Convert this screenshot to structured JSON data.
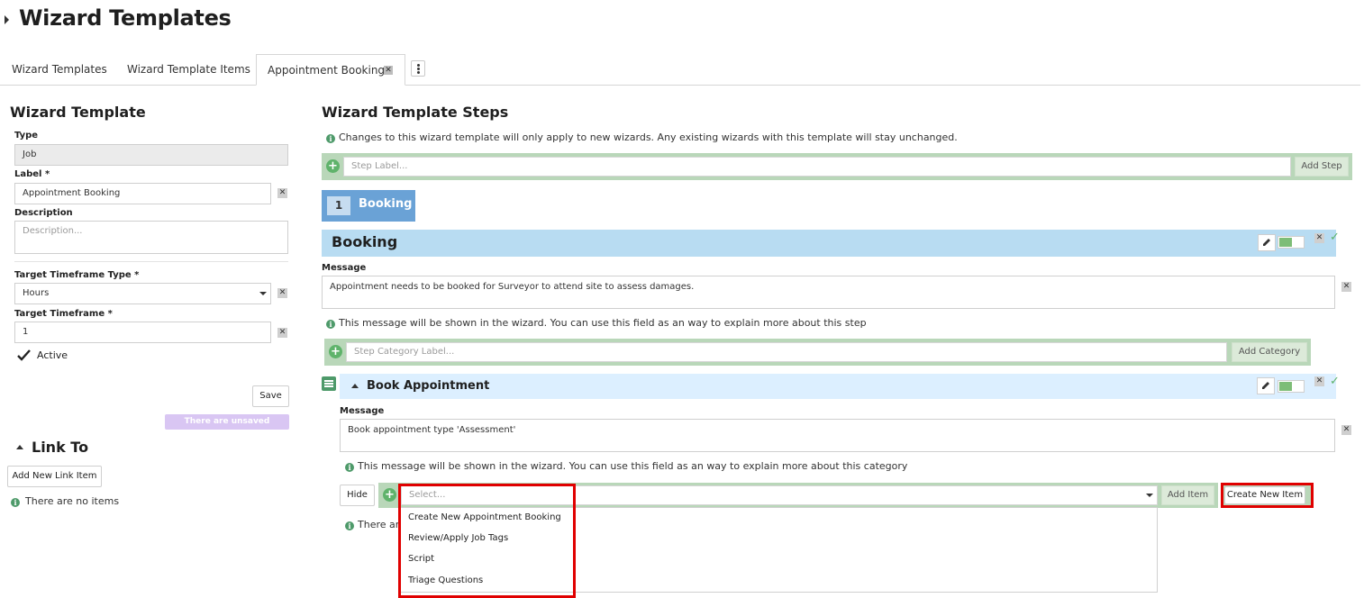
{
  "page": {
    "title": "Wizard Templates"
  },
  "tabs": [
    {
      "label": "Wizard Templates"
    },
    {
      "label": "Wizard Template Items"
    },
    {
      "label": "Appointment Booking"
    }
  ],
  "left": {
    "heading": "Wizard Template",
    "type_label": "Type",
    "type_value": "Job",
    "label_label": "Label *",
    "label_value": "Appointment Booking",
    "description_label": "Description",
    "description_placeholder": "Description...",
    "timeframe_type_label": "Target Timeframe Type *",
    "timeframe_type_value": "Hours",
    "timeframe_label": "Target Timeframe *",
    "timeframe_value": "1",
    "active_label": "Active",
    "active_checked": true,
    "save_label": "Save",
    "unsaved_badge": "There are unsaved changes",
    "link_heading": "Link To",
    "add_link_label": "Add New Link Item",
    "no_items_text": "There are no items"
  },
  "right": {
    "heading": "Wizard Template Steps",
    "info_changes": "Changes to this wizard template will only apply to new wizards. Any existing wizards with this template will stay unchanged.",
    "step_label_placeholder": "Step Label...",
    "add_step_label": "Add Step",
    "step": {
      "number": "1",
      "pill_name": "Booking",
      "title": "Booking",
      "message_label": "Message",
      "message_value": "Appointment needs to be booked for Surveyor to attend site to assess damages.",
      "message_info": "This message will be shown in the wizard. You can use this field as an way to explain more about this step"
    },
    "category_placeholder": "Step Category Label...",
    "add_category_label": "Add Category",
    "category": {
      "title": "Book Appointment",
      "message_label": "Message",
      "message_value": "Book appointment type 'Assessment'",
      "message_info": "This message will be shown in the wizard. You can use this field as an way to explain more about this category"
    },
    "hide_label": "Hide",
    "select_placeholder": "Select...",
    "add_item_label": "Add Item",
    "create_new_item_label": "Create New Item",
    "partial_info": "There are",
    "dropdown_options": [
      "Create New Appointment Booking",
      "Review/Apply Job Tags",
      "Script",
      "Triage Questions"
    ]
  },
  "colors": {
    "accent_green": "#5fb36b",
    "step_blue": "#6aa2d6",
    "highlight_red": "#e00000",
    "badge_purple": "#d9c6f3"
  }
}
